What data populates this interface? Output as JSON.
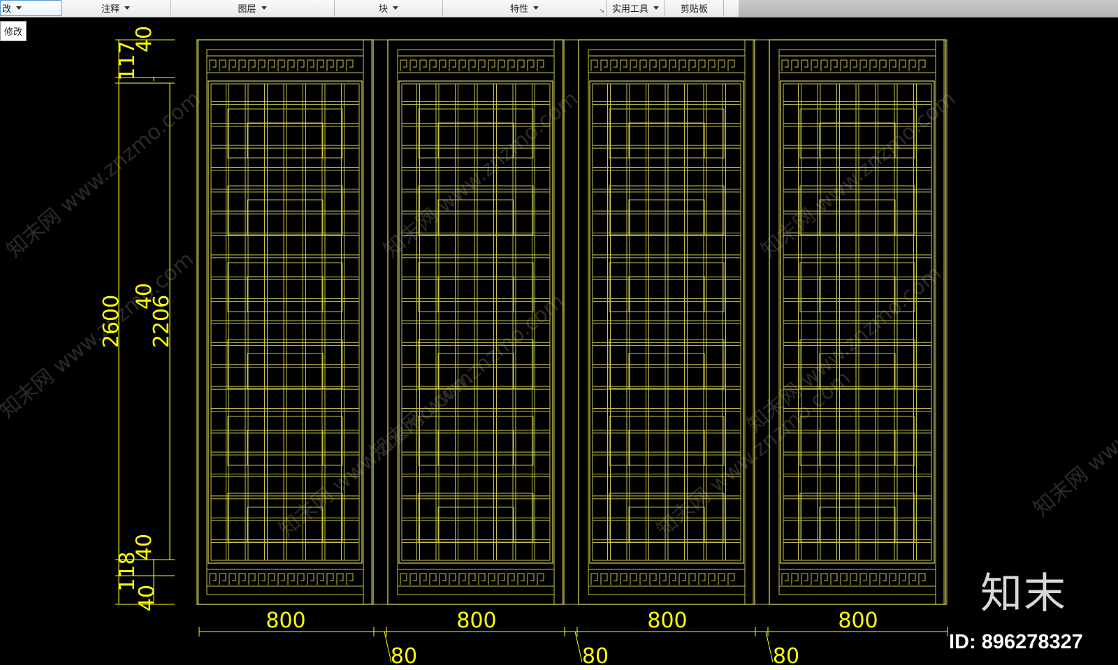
{
  "ribbon": {
    "panels": [
      {
        "label": "改"
      },
      {
        "label": "注释"
      },
      {
        "label": "图层"
      },
      {
        "label": "块"
      },
      {
        "label": "特性"
      },
      {
        "label": "实用工具"
      },
      {
        "label": "剪贴板"
      }
    ]
  },
  "tooltip": {
    "label": "修改"
  },
  "dimensions": {
    "vertical_left": [
      {
        "text": "40"
      },
      {
        "text": "117"
      },
      {
        "text": "2600"
      },
      {
        "text": "40"
      },
      {
        "text": "2206"
      },
      {
        "text": "40"
      },
      {
        "text": "118"
      },
      {
        "text": "40"
      }
    ],
    "widths": [
      "800",
      "800",
      "800",
      "800"
    ],
    "gaps": [
      "80",
      "80",
      "80"
    ]
  },
  "watermark": {
    "logo_text": "知末",
    "id_text": "ID: 896278327",
    "repeat_text": "知末网 www.znzmo.com"
  },
  "colors": {
    "background": "#000000",
    "linework": "#c9c34a",
    "dimension": "#ffff00"
  }
}
